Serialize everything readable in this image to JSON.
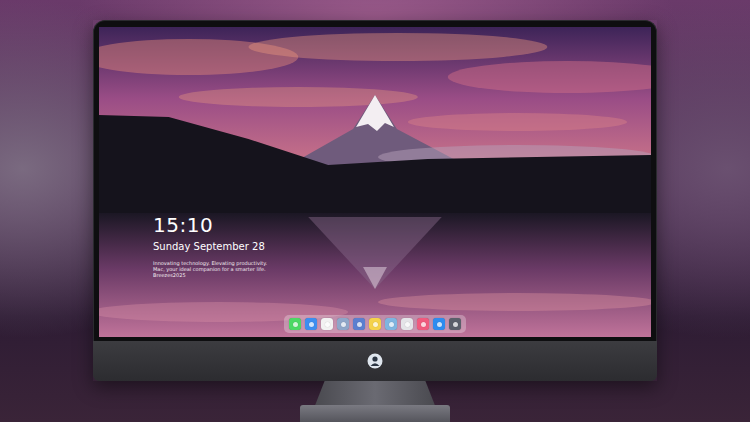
{
  "lock_screen": {
    "time": "15:10",
    "date": "Sunday September 28",
    "tagline": "Innovating technology. Elevating productivity. Mac, your ideal companion for a smarter life. Breezes2025"
  },
  "dock": {
    "items": [
      {
        "color": "#4cd964"
      },
      {
        "color": "#3b8ef0"
      },
      {
        "color": "#f2f2f2"
      },
      {
        "color": "#8fa6c9"
      },
      {
        "color": "#5b7fd0"
      },
      {
        "color": "#f5d24a"
      },
      {
        "color": "#7fb5e0"
      },
      {
        "color": "#e4e4e8"
      },
      {
        "color": "#f05a7e"
      },
      {
        "color": "#2d8cf0"
      },
      {
        "color": "#5a5f6a"
      }
    ]
  }
}
